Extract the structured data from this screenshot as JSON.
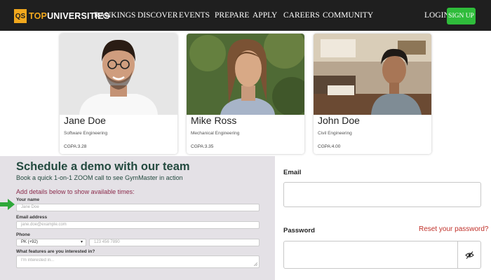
{
  "nav": {
    "logo_badge": "QS",
    "logo_word_accent": "TOP",
    "logo_word_rest": "UNIVERSITIES",
    "items": [
      "RANKINGS",
      "DISCOVER",
      "EVENTS",
      "PREPARE",
      "APPLY",
      "CAREERS",
      "COMMUNITY"
    ],
    "login": "LOGIN",
    "signup": "SIGN UP"
  },
  "profiles": [
    {
      "name": "Jane Doe",
      "department": "Software Engineering",
      "cgpa": "CGPA:3.28"
    },
    {
      "name": "Mike Ross",
      "department": "Mechanical Engineering",
      "cgpa": "CGPA:3.35"
    },
    {
      "name": "John Doe",
      "department": "Civil Engineering",
      "cgpa": "CGPA:4.00"
    }
  ],
  "demo": {
    "title": "Schedule a demo with our team",
    "subtitle": "Book a quick 1-on-1 ZOOM call to see GymMaster in action",
    "hint": "Add details below to show available times:",
    "name_label": "Your name",
    "name_placeholder": "Jane Doe",
    "email_label": "Email address",
    "email_placeholder": "jane.doe@example.com",
    "phone_label": "Phone",
    "country_code": "PK (+92)",
    "phone_placeholder": "123 456 7890",
    "features_label": "What features are you interested in?",
    "features_placeholder": "I'm interested in..."
  },
  "login": {
    "email_label": "Email",
    "password_label": "Password",
    "reset_link": "Reset your password?"
  },
  "colors": {
    "nav_bg": "#1f1f1f",
    "brand_accent": "#f2a81d",
    "signup_green": "#2fbc3b",
    "demo_title": "#234a3f",
    "demo_hint": "#8a2a4a",
    "reset_link": "#c0312a",
    "demo_bg": "#e4e1e6"
  },
  "icons": [
    "eye-slash-icon",
    "green-arrow-icon"
  ]
}
